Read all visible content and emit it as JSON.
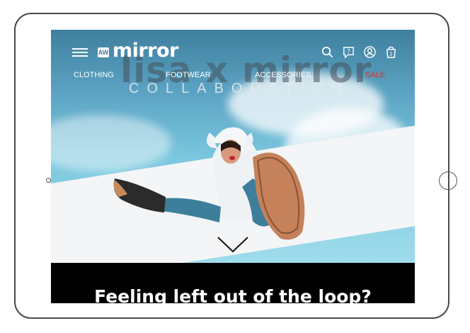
{
  "brand": {
    "logo_text": "mirror",
    "logo_mark": "AW"
  },
  "nav": {
    "items": [
      {
        "label": "CLOTHING"
      },
      {
        "label": "FOOTWEAR"
      },
      {
        "label": "ACCESSORIES"
      },
      {
        "label": "SALE"
      }
    ],
    "sale_color": "#e0301e"
  },
  "header_icons": [
    "menu-icon",
    "search-icon",
    "help-icon",
    "account-icon",
    "shopping-bag-icon"
  ],
  "hero": {
    "headline": "lisa x mirror",
    "subline": "COLLABORATION",
    "scroll_icon": "chevron-down-icon"
  },
  "footer": {
    "heading": "Feeling left out of the loop?"
  },
  "colors": {
    "sky": "#7ac7de",
    "band": "#000000",
    "text": "#ffffff"
  }
}
